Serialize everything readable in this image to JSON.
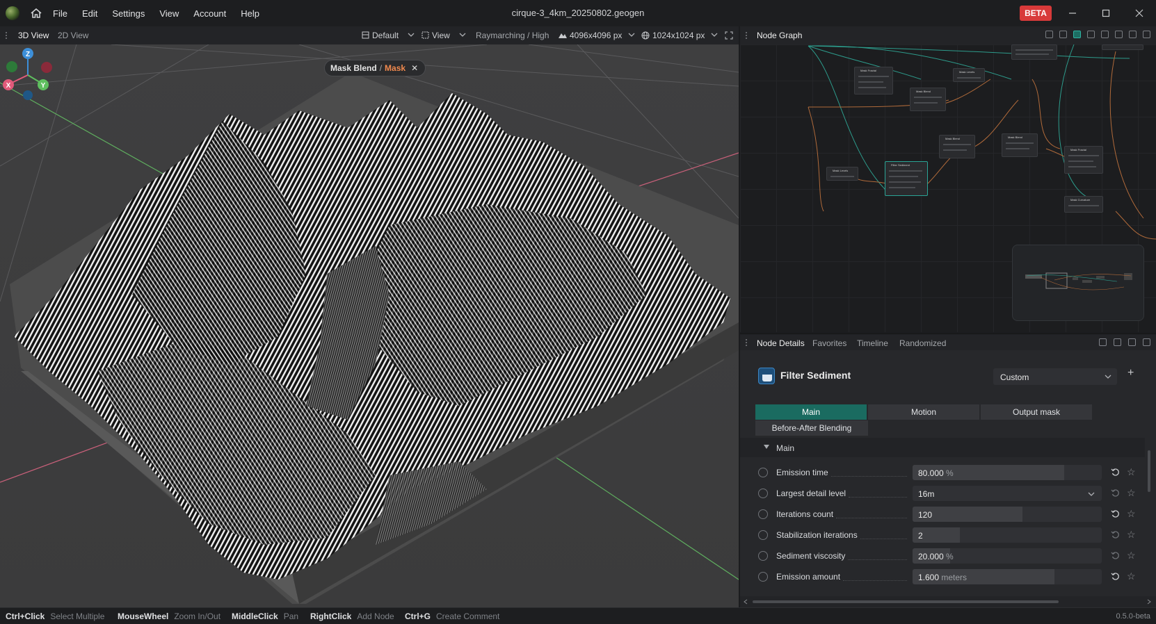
{
  "window": {
    "title": "cirque-3_4km_20250802.geogen",
    "beta_label": "BETA",
    "menu": [
      "File",
      "Edit",
      "Settings",
      "View",
      "Account",
      "Help"
    ]
  },
  "viewport_toolbar": {
    "tabs": [
      "3D View",
      "2D View"
    ],
    "layout": "Default",
    "view": "View",
    "render_mode": "Raymarching / High",
    "terrain_resolution": "4096x4096 px",
    "preview_resolution": "1024x1024 px"
  },
  "viewport": {
    "breadcrumb": {
      "node": "Mask Blend",
      "separator": "/",
      "output": "Mask"
    },
    "gizmo": {
      "z": "Z",
      "x": "X",
      "y": "Y"
    }
  },
  "node_graph": {
    "title": "Node Graph"
  },
  "node_details": {
    "tabs": [
      "Node Details",
      "Favorites",
      "Timeline",
      "Randomized"
    ],
    "node_name": "Filter Sediment",
    "preset": "Custom",
    "param_tabs": [
      "Main",
      "Motion",
      "Output mask",
      "Before-After Blending"
    ],
    "section": "Main",
    "params": [
      {
        "label": "Emission time",
        "value": "80.000",
        "unit": "%",
        "fraction": 0.8
      },
      {
        "label": "Largest detail level",
        "value": "16m",
        "unit": "",
        "fraction": 0
      },
      {
        "label": "Iterations count",
        "value": "120",
        "unit": "",
        "fraction": 0.58
      },
      {
        "label": "Stabilization iterations",
        "value": "2",
        "unit": "",
        "fraction": 0.25
      },
      {
        "label": "Sediment viscosity",
        "value": "20.000",
        "unit": "%",
        "fraction": 0.2
      },
      {
        "label": "Emission amount",
        "value": "1.600",
        "unit": "meters",
        "fraction": 0.75
      }
    ]
  },
  "statusbar": {
    "hints": [
      {
        "key": "Ctrl+Click",
        "action": "Select Multiple"
      },
      {
        "key": "MouseWheel",
        "action": "Zoom In/Out"
      },
      {
        "key": "MiddleClick",
        "action": "Pan"
      },
      {
        "key": "RightClick",
        "action": "Add Node"
      },
      {
        "key": "Ctrl+G",
        "action": "Create Comment"
      }
    ],
    "version": "0.5.0-beta"
  },
  "colors": {
    "accent_teal": "#1a6b60",
    "beta_red": "#d83a3a",
    "breadcrumb_accent": "#f0894e"
  }
}
